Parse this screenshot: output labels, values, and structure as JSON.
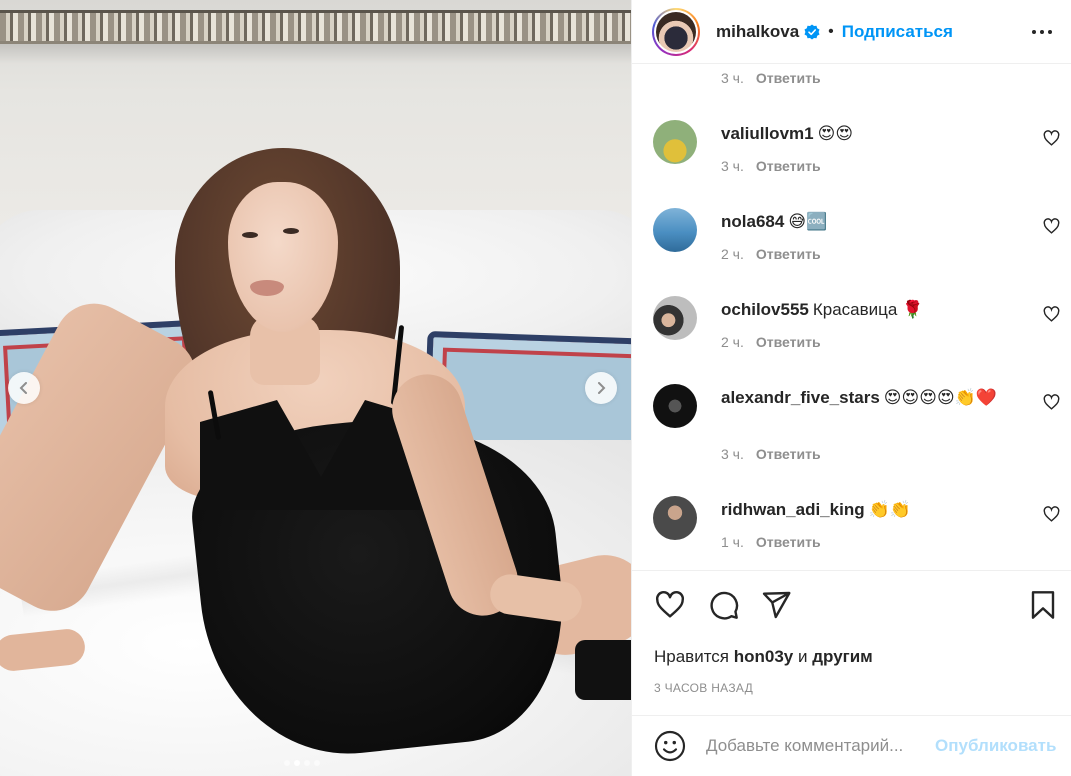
{
  "post": {
    "author": "mihalkova",
    "follow_label": "Подписаться",
    "separator": "•",
    "carousel": {
      "total_slides": 4,
      "active_slide": 1
    }
  },
  "top_meta": {
    "time": "3 ч.",
    "reply": "Ответить"
  },
  "comments": [
    {
      "user": "valiullovm1",
      "text": "😍😍",
      "time": "3 ч.",
      "reply": "Ответить"
    },
    {
      "user": "nola684",
      "text": "😅🆒",
      "time": "2 ч.",
      "reply": "Ответить"
    },
    {
      "user": "ochilov555",
      "text": "Красавица 🌹",
      "time": "2 ч.",
      "reply": "Ответить"
    },
    {
      "user": "alexandr_five_stars",
      "text": "😍😍😍😍👏❤️",
      "time": "3 ч.",
      "reply": "Ответить"
    },
    {
      "user": "ridhwan_adi_king",
      "text": "👏👏",
      "time": "1 ч.",
      "reply": "Ответить"
    }
  ],
  "likes": {
    "prefix": "Нравится",
    "user": "hon03y",
    "joiner": "и",
    "others": "другим"
  },
  "timestamp": "3 ЧАСОВ НАЗАД",
  "add_comment": {
    "placeholder": "Добавьте комментарий...",
    "publish_label": "Опубликовать"
  },
  "colors": {
    "link_blue": "#0095f6",
    "muted": "#8e8e8e",
    "publish_disabled": "#b2dffc",
    "verified": "#0095f6"
  },
  "icons": [
    "verified-badge-icon",
    "more-options-icon",
    "heart-icon",
    "comment-icon",
    "share-icon",
    "bookmark-icon",
    "smile-icon",
    "chevron-left-icon",
    "chevron-right-icon"
  ]
}
